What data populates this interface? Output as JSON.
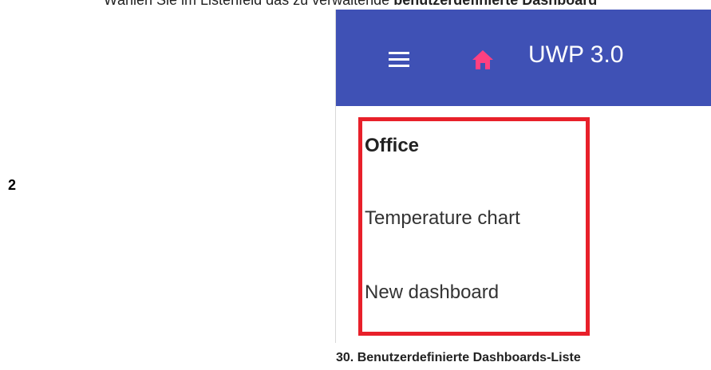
{
  "instruction": {
    "prefix": "Wählen Sie im Listenfeld das zu verwaltende ",
    "emphasis": "benutzerdefinierte Dashboard"
  },
  "step_number": "2",
  "app": {
    "menu_icon": "hamburger-menu-icon",
    "home_icon": "home-icon",
    "title": "UWP 3.0",
    "colors": {
      "app_bar": "#3f51b5",
      "home_icon": "#ff4081",
      "highlight": "#e8202a"
    }
  },
  "dashboard_list": {
    "items": [
      {
        "label": "Office",
        "selected": true
      },
      {
        "label": "Temperature chart",
        "selected": false
      },
      {
        "label": "New dashboard",
        "selected": false
      }
    ]
  },
  "caption": "30. Benutzerdefinierte Dashboards-Liste"
}
